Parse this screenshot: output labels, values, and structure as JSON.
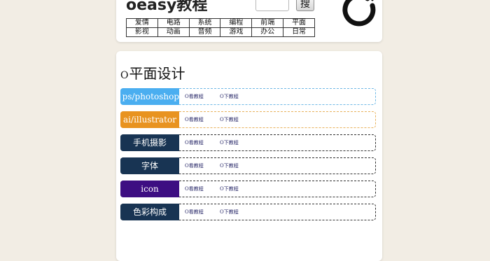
{
  "header": {
    "site_title": "oeasy教程",
    "search_button_label": "搜",
    "logo_icon": "enso-circle-icon",
    "nav": [
      [
        "爱情",
        "电路",
        "系统",
        "编程",
        "前端",
        "平面"
      ],
      [
        "影视",
        "动画",
        "音频",
        "游戏",
        "办公",
        "日常"
      ]
    ]
  },
  "section": {
    "title_icon": "ring",
    "title_glyph": "O",
    "title": "平面设计",
    "rows": [
      {
        "tag": "ps/photoshop",
        "color": "#4aaef0",
        "border": "#6fb8e6",
        "watch": "O看教程",
        "download": "O下教程"
      },
      {
        "tag": "ai/illustrator",
        "color": "#e89320",
        "border": "#e8b25c",
        "watch": "O看教程",
        "download": "O下教程"
      },
      {
        "tag": "手机摄影",
        "color": "#183453",
        "border": "#333333",
        "watch": "O看教程",
        "download": "O下教程"
      },
      {
        "tag": "字体",
        "color": "#183453",
        "border": "#333333",
        "watch": "O看教程",
        "download": "O下教程"
      },
      {
        "tag": "icon",
        "color": "#3d0e82",
        "border": "#333333",
        "watch": "O看教程",
        "download": "O下教程"
      },
      {
        "tag": "色彩构成",
        "color": "#183453",
        "border": "#333333",
        "watch": "O看教程",
        "download": "O下教程"
      }
    ]
  }
}
